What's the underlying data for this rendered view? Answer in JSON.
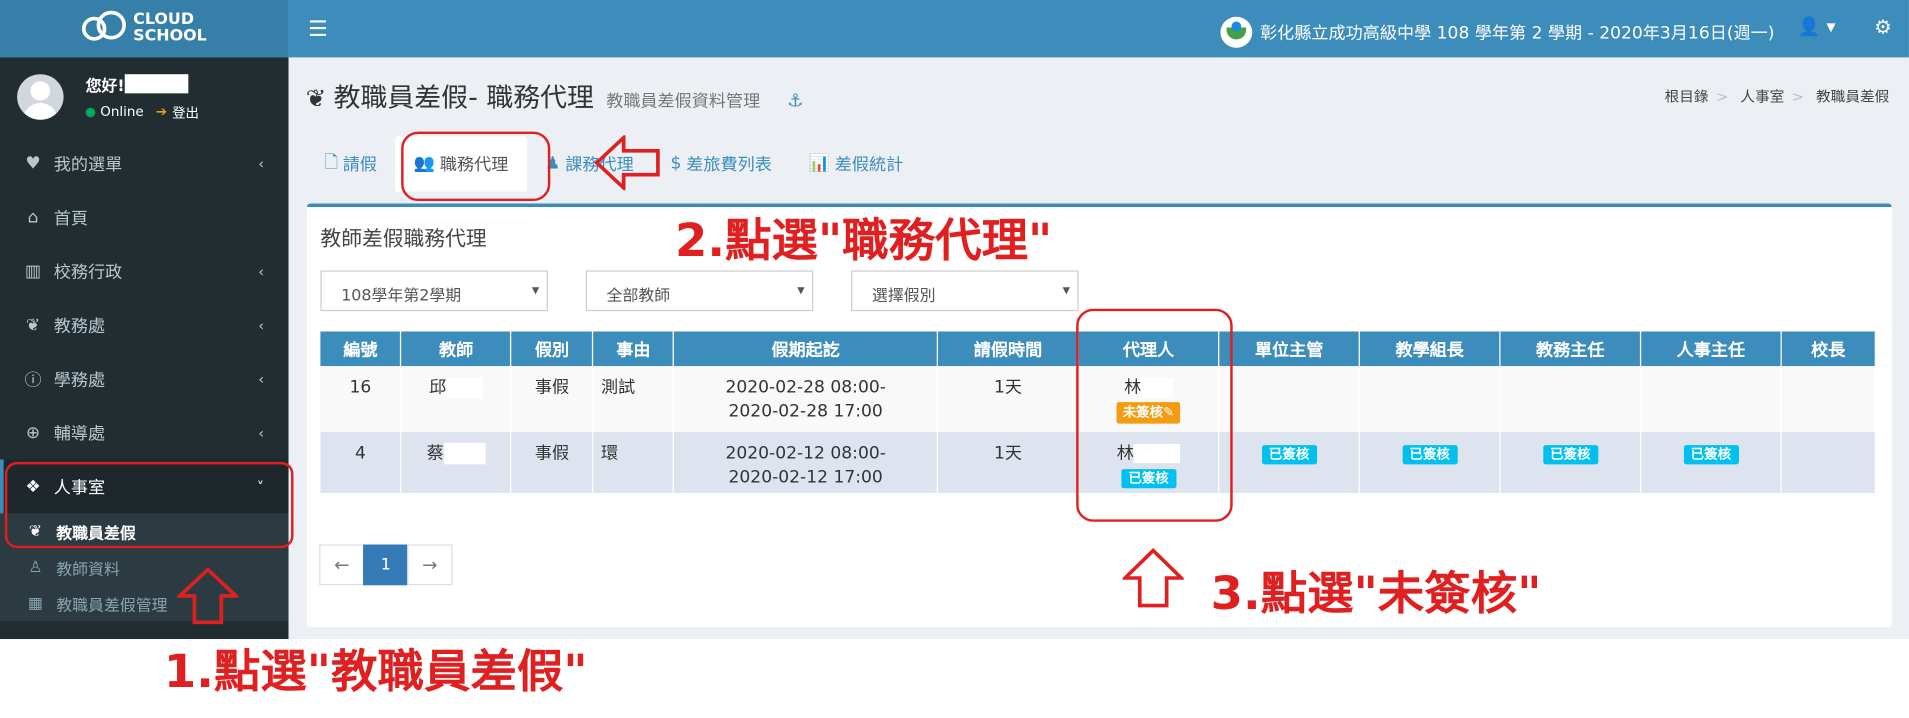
{
  "brand": {
    "line1": "CLOUD",
    "line2": "SCHOOL"
  },
  "user": {
    "greeting": "您好!",
    "status": "Online",
    "logout": "登出"
  },
  "sidebar": {
    "items": [
      {
        "icon": "heart-icon",
        "label": "我的選單"
      },
      {
        "icon": "home-icon",
        "label": "首頁"
      },
      {
        "icon": "bank-icon",
        "label": "校務行政"
      },
      {
        "icon": "leaf-icon",
        "label": "教務處"
      },
      {
        "icon": "info-icon",
        "label": "學務處"
      },
      {
        "icon": "lifebuoy-icon",
        "label": "輔導處"
      },
      {
        "icon": "cubes-icon",
        "label": "人事室"
      }
    ],
    "sub_items": [
      {
        "icon": "leaf-icon",
        "label": "教職員差假"
      },
      {
        "icon": "person-icon",
        "label": "教師資料"
      },
      {
        "icon": "grid-icon",
        "label": "教職員差假管理"
      }
    ]
  },
  "header": {
    "school": "彰化縣立成功高級中學 108 學年第 2 學期 - 2020年3月16日(週一)"
  },
  "page": {
    "title": "教職員差假- 職務代理",
    "subtitle": "教職員差假資料管理",
    "breadcrumb": [
      "根目錄",
      "人事室",
      "教職員差假"
    ]
  },
  "tabs": [
    {
      "icon": "file-icon",
      "label": "請假"
    },
    {
      "icon": "users-icon",
      "label": "職務代理"
    },
    {
      "icon": "user-icon",
      "label": "課務代理"
    },
    {
      "icon": "dollar-icon",
      "label": "差旅費列表"
    },
    {
      "icon": "chart-icon",
      "label": "差假統計"
    }
  ],
  "box": {
    "title": "教師差假職務代理",
    "filters": [
      "108學年第2學期",
      "全部教師",
      "選擇假別"
    ]
  },
  "table": {
    "headers": [
      "編號",
      "教師",
      "假別",
      "事由",
      "假期起訖",
      "請假時間",
      "代理人",
      "單位主管",
      "教學組長",
      "教務主任",
      "人事主任",
      "校長"
    ],
    "rows": [
      {
        "id": "16",
        "teacher": "邱",
        "type": "事假",
        "reason": "測試",
        "start": "2020-02-28 08:00-",
        "end": "2020-02-28 17:00",
        "duration": "1天",
        "agent": "林",
        "agent_badge": "未簽核",
        "approvals": [
          "",
          "",
          "",
          "",
          ""
        ]
      },
      {
        "id": "4",
        "teacher": "蔡",
        "type": "事假",
        "reason": "環",
        "start": "2020-02-12 08:00-",
        "end": "2020-02-12 17:00",
        "duration": "1天",
        "agent": "林",
        "agent_badge": "已簽核",
        "approvals": [
          "已簽核",
          "已簽核",
          "已簽核",
          "已簽核",
          ""
        ]
      }
    ]
  },
  "pagination": {
    "prev": "←",
    "current": "1",
    "next": "→"
  },
  "annotations": {
    "step1": "1.點選\"教職員差假\"",
    "step2": "2.點選\"職務代理\"",
    "step3": "3.點選\"未簽核\""
  },
  "colors": {
    "header": "#3c8dbc",
    "sidebar": "#222d32",
    "annotation": "#e02020",
    "warn_badge": "#f39c12",
    "ok_badge": "#00c0ef"
  }
}
